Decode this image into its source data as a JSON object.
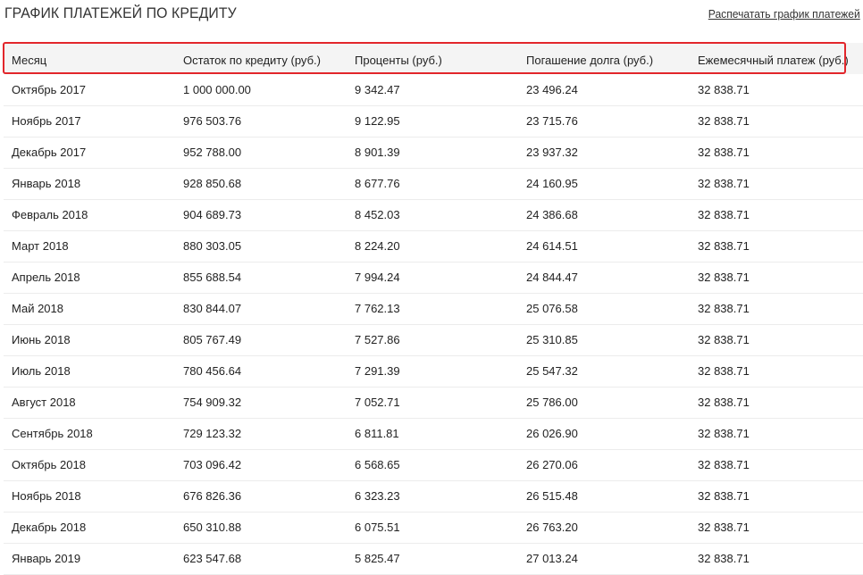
{
  "header": {
    "title": "ГРАФИК ПЛАТЕЖЕЙ ПО КРЕДИТУ",
    "print_link": "Распечатать график платежей"
  },
  "table": {
    "columns": [
      "Месяц",
      "Остаток по кредиту (руб.)",
      "Проценты (руб.)",
      "Погашение долга (руб.)",
      "Ежемесячный платеж (руб.)"
    ],
    "rows": [
      [
        "Октябрь 2017",
        "1 000 000.00",
        "9 342.47",
        "23 496.24",
        "32 838.71"
      ],
      [
        "Ноябрь 2017",
        "976 503.76",
        "9 122.95",
        "23 715.76",
        "32 838.71"
      ],
      [
        "Декабрь 2017",
        "952 788.00",
        "8 901.39",
        "23 937.32",
        "32 838.71"
      ],
      [
        "Январь 2018",
        "928 850.68",
        "8 677.76",
        "24 160.95",
        "32 838.71"
      ],
      [
        "Февраль 2018",
        "904 689.73",
        "8 452.03",
        "24 386.68",
        "32 838.71"
      ],
      [
        "Март 2018",
        "880 303.05",
        "8 224.20",
        "24 614.51",
        "32 838.71"
      ],
      [
        "Апрель 2018",
        "855 688.54",
        "7 994.24",
        "24 844.47",
        "32 838.71"
      ],
      [
        "Май 2018",
        "830 844.07",
        "7 762.13",
        "25 076.58",
        "32 838.71"
      ],
      [
        "Июнь 2018",
        "805 767.49",
        "7 527.86",
        "25 310.85",
        "32 838.71"
      ],
      [
        "Июль 2018",
        "780 456.64",
        "7 291.39",
        "25 547.32",
        "32 838.71"
      ],
      [
        "Август 2018",
        "754 909.32",
        "7 052.71",
        "25 786.00",
        "32 838.71"
      ],
      [
        "Сентябрь 2018",
        "729 123.32",
        "6 811.81",
        "26 026.90",
        "32 838.71"
      ],
      [
        "Октябрь 2018",
        "703 096.42",
        "6 568.65",
        "26 270.06",
        "32 838.71"
      ],
      [
        "Ноябрь 2018",
        "676 826.36",
        "6 323.23",
        "26 515.48",
        "32 838.71"
      ],
      [
        "Декабрь 2018",
        "650 310.88",
        "6 075.51",
        "26 763.20",
        "32 838.71"
      ],
      [
        "Январь 2019",
        "623 547.68",
        "5 825.47",
        "27 013.24",
        "32 838.71"
      ]
    ]
  },
  "colors": {
    "highlight": "#e2262b",
    "header_bg": "#f4f4f4",
    "row_divider": "#ececec"
  }
}
